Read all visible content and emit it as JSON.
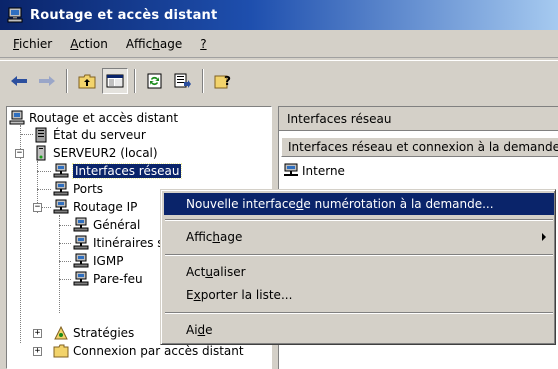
{
  "window": {
    "title": "Routage et accès distant"
  },
  "menubar": [
    {
      "pre": "",
      "key": "F",
      "post": "ichier"
    },
    {
      "pre": "",
      "key": "A",
      "post": "ction"
    },
    {
      "pre": "Affic",
      "key": "h",
      "post": "age"
    },
    {
      "pre": "",
      "key": "?",
      "post": ""
    }
  ],
  "toolbar": {
    "icons": [
      "back-arrow-icon",
      "forward-arrow-icon",
      "up-folder-icon",
      "show-hide-tree-icon",
      "refresh-icon",
      "export-list-icon",
      "help-icon"
    ]
  },
  "tree": {
    "root": "Routage et accès distant",
    "server_status": "État du serveur",
    "server": "SERVEUR2 (local)",
    "interfaces": "Interfaces réseau",
    "ports": "Ports",
    "routing_ip": "Routage IP",
    "general": "Général",
    "routes": "Itinéraires statiques",
    "igmp": "IGMP",
    "firewall": "Pare-feu",
    "policies": "Stratégies",
    "remote_access": "Connexion par accès distant"
  },
  "right_pane": {
    "header": "Interfaces réseau",
    "column_header": "Interfaces réseau et connexion à la demande",
    "rows": [
      {
        "name": "Interne"
      }
    ]
  },
  "context_menu": {
    "items": [
      {
        "pre": "Nouvelle interface ",
        "key": "d",
        "post": "e numérotation à la demande..."
      },
      {
        "pre": "Affic",
        "key": "h",
        "post": "age"
      },
      {
        "pre": "Act",
        "key": "u",
        "post": "aliser"
      },
      {
        "pre": "E",
        "key": "x",
        "post": "porter la liste..."
      },
      {
        "pre": "Ai",
        "key": "d",
        "post": "e"
      }
    ]
  },
  "colors": {
    "title_start": "#0a246a",
    "title_end": "#a6caf0",
    "selection": "#0a246a",
    "face": "#d4d0c8"
  }
}
